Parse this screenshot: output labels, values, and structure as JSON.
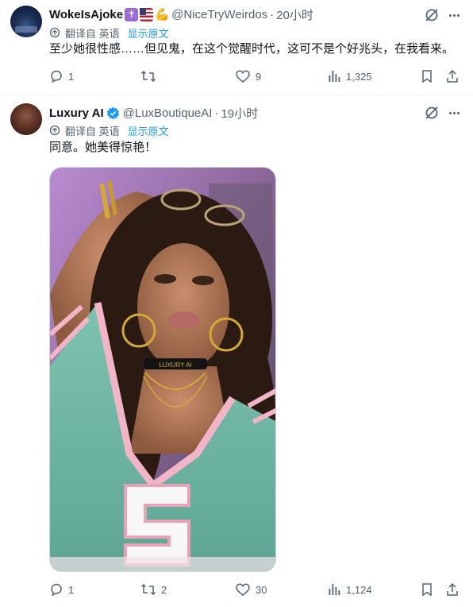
{
  "tweets": [
    {
      "display_name": "WokeIsAjoke",
      "name_emojis": [
        "✝",
        "",
        "💪"
      ],
      "handle": "@NiceTryWeirdos",
      "separator": "·",
      "time": "20小时",
      "translate_label": "翻译自 英语",
      "show_original": "显示原文",
      "text": "至少她很性感……但见鬼，在这个觉醒时代，这可不是个好兆头，在我看来。",
      "replies": "1",
      "retweets": "",
      "likes": "9",
      "views": "1,325"
    },
    {
      "display_name": "Luxury AI",
      "verified": true,
      "handle": "@LuxBoutiqueAI",
      "separator": "·",
      "time": "19小时",
      "translate_label": "翻译自 英语",
      "show_original": "显示原文",
      "text": "同意。她美得惊艳！",
      "media_choker_text": "LUXURY AI",
      "replies": "1",
      "retweets": "2",
      "likes": "30",
      "views": "1,124"
    }
  ],
  "colors": {
    "text_primary": "#0f1419",
    "text_secondary": "#536471",
    "link": "#1d9bf0",
    "border": "#eff3f4"
  },
  "icons": [
    "grok-icon",
    "more-icon",
    "translate-icon",
    "reply-icon",
    "retweet-icon",
    "like-icon",
    "views-icon",
    "bookmark-icon",
    "share-icon",
    "verified-badge-icon"
  ]
}
